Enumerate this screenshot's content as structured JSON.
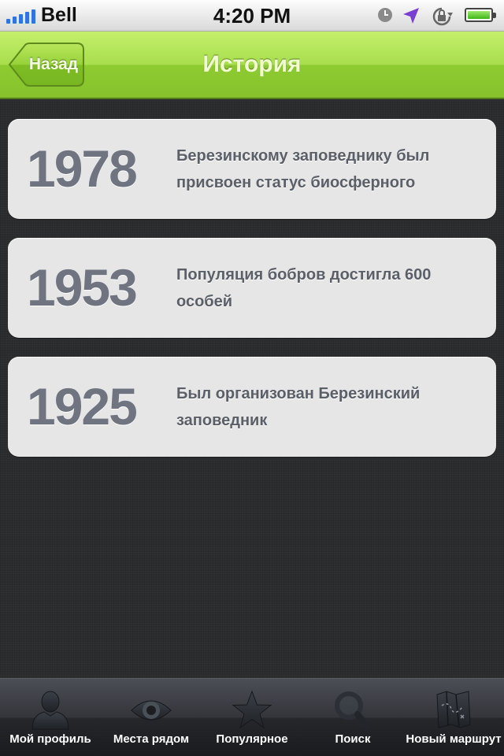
{
  "status_bar": {
    "carrier": "Bell",
    "time": "4:20 PM"
  },
  "nav": {
    "back_label": "Назад",
    "title": "История"
  },
  "history": [
    {
      "year": "1978",
      "text": "Березинскому заповеднику был присвоен статус биосферного"
    },
    {
      "year": "1953",
      "text": "Популяция бобров достигла 600 особей"
    },
    {
      "year": "1925",
      "text": "Был организован Березинский заповедник"
    }
  ],
  "tabs": [
    {
      "label": "Мой профиль",
      "icon": "person-icon"
    },
    {
      "label": "Места рядом",
      "icon": "eye-icon"
    },
    {
      "label": "Популярное",
      "icon": "star-icon"
    },
    {
      "label": "Поиск",
      "icon": "magnifier-icon"
    },
    {
      "label": "Новый маршрут",
      "icon": "map-icon"
    }
  ],
  "colors": {
    "nav_green": "#a8de4d",
    "card_bg": "#e6e6e6",
    "year_text": "#6f7480",
    "background": "#2b2c2e"
  }
}
